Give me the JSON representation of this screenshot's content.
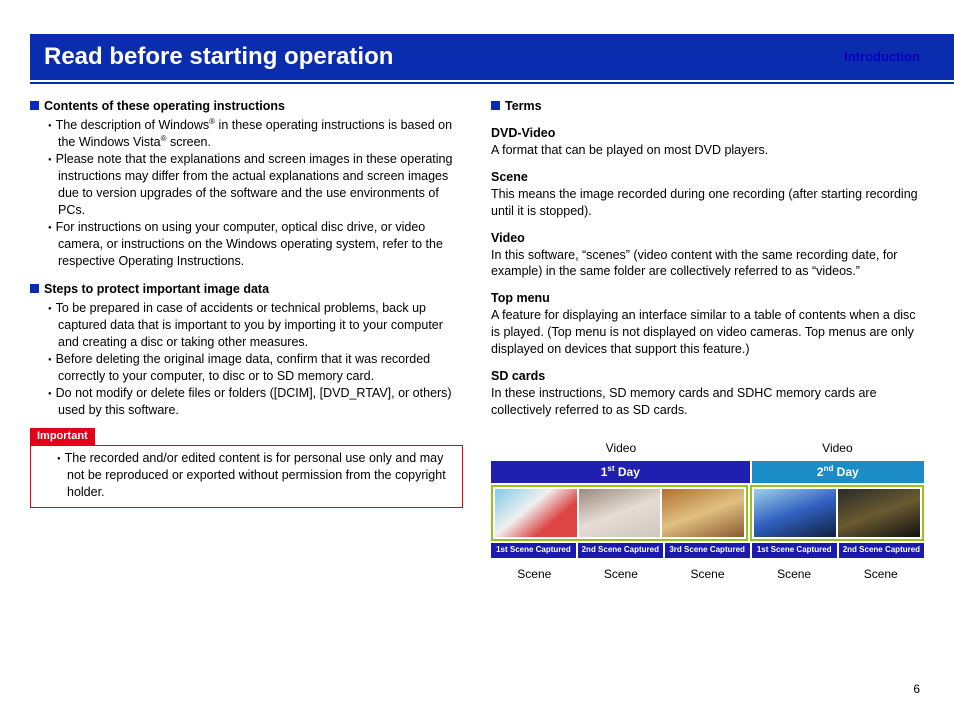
{
  "header": {
    "category": "Introduction",
    "title": "Read before starting operation"
  },
  "left": {
    "sec1_title": "Contents of these operating instructions",
    "sec1_b1a": "The description of Windows",
    "sec1_b1b": " in these operating instructions is based on the Windows Vista",
    "sec1_b1c": " screen.",
    "sec1_b2": "Please note that the explanations and screen images in these operating instructions may differ from the actual explanations and screen images due to version upgrades of the software and the use environments of PCs.",
    "sec1_b3": "For instructions on using your computer, optical disc drive, or video camera, or instructions on the Windows operating system, refer to the respective Operating Instructions.",
    "sec2_title": "Steps to protect important image data",
    "sec2_b1": "To be prepared in case of accidents or technical problems, back up captured data that is important to you by importing it to your computer and creating a disc or taking other measures.",
    "sec2_b2": "Before deleting the original image data, confirm that it was recorded correctly to your computer, to disc or to SD memory card.",
    "sec2_b3": "Do not modify or delete files or folders ([DCIM], [DVD_RTAV], or others) used by this software.",
    "important_label": "Important",
    "important_text": "The recorded and/or edited content is for personal use only and may not be reproduced or exported without permission from the copyright holder."
  },
  "right": {
    "terms_title": "Terms",
    "t1_h": "DVD-Video",
    "t1_b": "A format that can be played on most DVD players.",
    "t2_h": "Scene",
    "t2_b": "This means the image recorded during one recording (after starting recording until it is stopped).",
    "t3_h": "Video",
    "t3_b": "In this software, “scenes” (video content with the same recording date, for example) in the same folder are collectively referred to as “videos.”",
    "t4_h": "Top menu",
    "t4_b": "A feature for displaying an interface similar to a table of contents when a disc is played. (Top menu is not displayed on video cameras. Top menus are only displayed on devices that support this feature.)",
    "t5_h": "SD cards",
    "t5_b": "In these instructions, SD memory cards and SDHC memory cards are collectively referred to as SD cards."
  },
  "diagram": {
    "video_label": "Video",
    "day1_pre": "1",
    "day1_ord": "st",
    "day1_post": " Day",
    "day2_pre": "2",
    "day2_ord": "nd",
    "day2_post": " Day",
    "cap1": "1st Scene Captured",
    "cap2": "2nd Scene Captured",
    "cap3": "3rd Scene Captured",
    "cap4": "1st Scene Captured",
    "cap5": "2nd Scene Captured",
    "scene_label": "Scene",
    "thumbs": {
      "c1": "linear-gradient(140deg,#7ecbe8,#f0f0f0 40%,#d44 70%)",
      "c2": "linear-gradient(160deg,#9c8a80,#e6dcd4 50%,#cfc6c0)",
      "c3": "linear-gradient(160deg,#b07030,#e0c080 50%,#8a5a30)",
      "c4": "linear-gradient(160deg,#a0d0e8,#3060c0 50%,#102040)",
      "c5": "linear-gradient(160deg,#2a2a2a,#6a5a30 50%,#101010)"
    }
  },
  "page_number": "6",
  "reg_mark": "®"
}
